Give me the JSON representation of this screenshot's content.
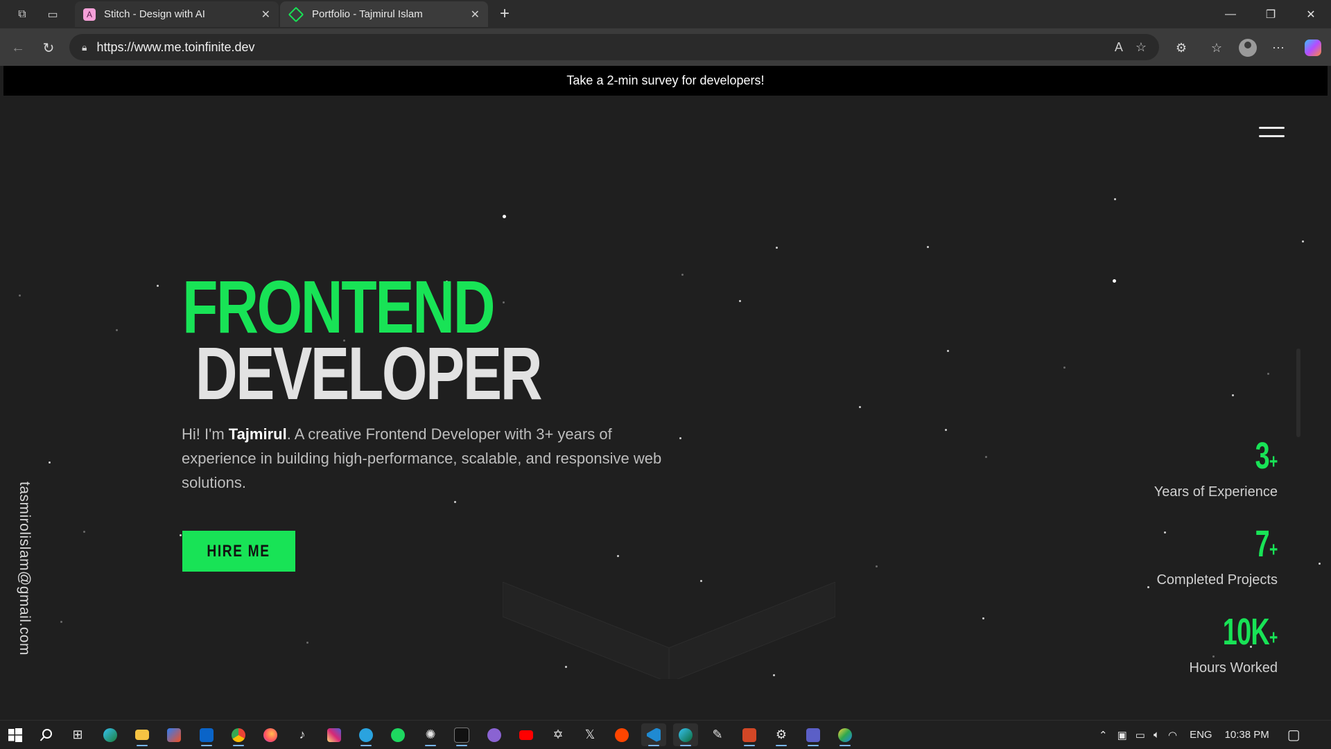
{
  "browser": {
    "tabs": [
      {
        "title": "Stitch - Design with AI",
        "favicon_color": "#f5a0d8"
      },
      {
        "title": "Portfolio - Tajmirul Islam",
        "favicon_color": "#18e356"
      }
    ],
    "new_tab_symbol": "+",
    "url": "https://www.me.toinfinite.dev",
    "window_controls": {
      "minimize": "—",
      "restore": "❐",
      "close": "✕"
    }
  },
  "page": {
    "survey_banner": "Take a 2-min survey for developers!",
    "email": "tasmirolislam@gmail.com",
    "hero": {
      "title_line1": "FRONTEND",
      "title_line2": "DEVELOPER",
      "desc_prefix": "Hi! I'm ",
      "desc_name": "Tajmirul",
      "desc_suffix": ". A creative Frontend Developer with 3+ years of experience in building high-performance, scalable, and responsive web solutions.",
      "cta": "HIRE ME"
    },
    "stats": [
      {
        "value": "3",
        "suffix": "+",
        "label": "Years of Experience"
      },
      {
        "value": "7",
        "suffix": "+",
        "label": "Completed Projects"
      },
      {
        "value": "10K",
        "suffix": "+",
        "label": "Hours Worked"
      }
    ],
    "colors": {
      "accent": "#18e356",
      "background": "#1f1f1f",
      "banner": "#000000"
    }
  },
  "taskbar": {
    "tray": {
      "language": "ENG",
      "time": "10:38 PM"
    },
    "apps": [
      "start-icon",
      "search-icon",
      "task-view-icon",
      "edge-icon",
      "file-explorer-icon",
      "store-icon",
      "outlook-icon",
      "chrome-icon",
      "firefox-icon",
      "tiktok-icon",
      "instagram-icon",
      "telegram-icon",
      "spotify-icon",
      "chatgpt-icon",
      "terminal-icon",
      "github-icon",
      "youtube-icon",
      "proton-icon",
      "x-icon",
      "reddit-icon",
      "vscode-icon",
      "edge-dev-icon",
      "claude-icon",
      "powerpoint-icon",
      "settings-icon",
      "teams-icon",
      "edge-canary-icon"
    ]
  }
}
